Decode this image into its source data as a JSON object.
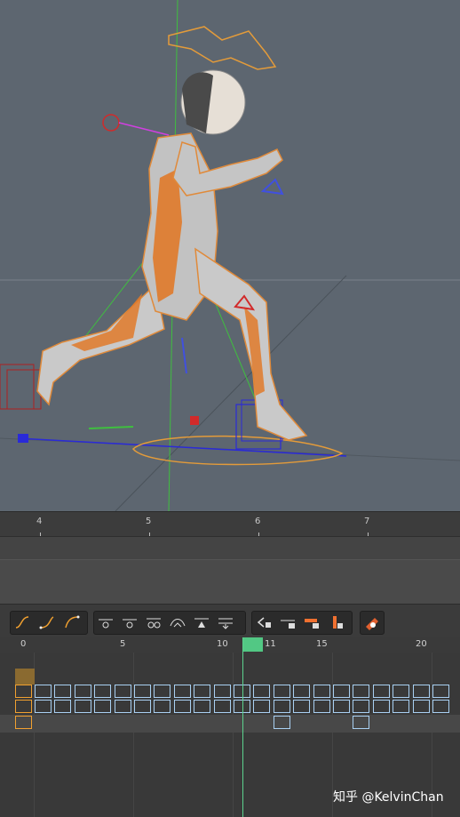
{
  "viewport": {
    "label": "3D viewport with rigged character",
    "background": "#5d6670"
  },
  "ruler": {
    "labels": [
      "4",
      "5",
      "6",
      "7"
    ]
  },
  "toolbar": {
    "groups": [
      [
        "spline-icon",
        "ease-in-icon",
        "ease-out-icon"
      ],
      [
        "key-left-icon",
        "key-right-icon",
        "key-both-icon",
        "key-curve-icon",
        "key-drop-icon",
        "key-stack-icon"
      ],
      [
        "key-lock-left-icon",
        "key-lock-mid-icon",
        "key-lock-bar-icon",
        "key-lock-vert-icon"
      ],
      [
        "record-key-icon"
      ]
    ]
  },
  "timeline": {
    "frame_labels": [
      "0",
      "5",
      "10",
      "11",
      "15",
      "20"
    ],
    "current_frame": "11",
    "playhead_color": "#5cd38e",
    "key_color": "#a9d0f2",
    "selected_key_color": "#f0a030"
  },
  "watermark": "知乎 @KelvinChan"
}
